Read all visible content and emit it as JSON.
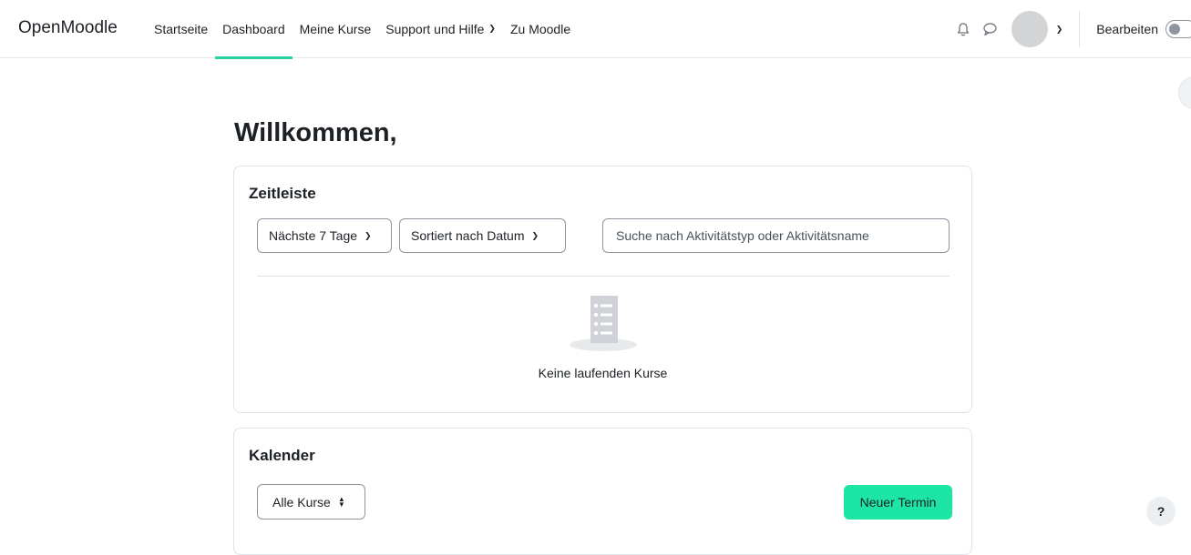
{
  "brand": "OpenMoodle",
  "nav": {
    "items": [
      {
        "label": "Startseite"
      },
      {
        "label": "Dashboard"
      },
      {
        "label": "Meine Kurse"
      },
      {
        "label": "Support und Hilfe"
      },
      {
        "label": "Zu Moodle"
      }
    ],
    "active": "Dashboard",
    "edit_label": "Bearbeiten",
    "edit_mode": false
  },
  "icons": {
    "notifications": "bell-icon",
    "messages": "chat-bubble-icon",
    "user_menu": "chevron-down-icon",
    "help": "question-icon"
  },
  "colors": {
    "accent": "#28d3a1",
    "primary_button": "#1de5a3"
  },
  "page": {
    "title": "Willkommen,"
  },
  "timeline": {
    "title": "Zeitleiste",
    "filter_days": "Nächste 7 Tage",
    "sort": "Sortiert nach Datum",
    "search_placeholder": "Suche nach Aktivitätstyp oder Aktivitätsname",
    "empty_text": "Keine laufenden Kurse"
  },
  "calendar": {
    "title": "Kalender",
    "course_filter": "Alle Kurse",
    "new_event_label": "Neuer Termin"
  },
  "help": {
    "label": "?"
  }
}
